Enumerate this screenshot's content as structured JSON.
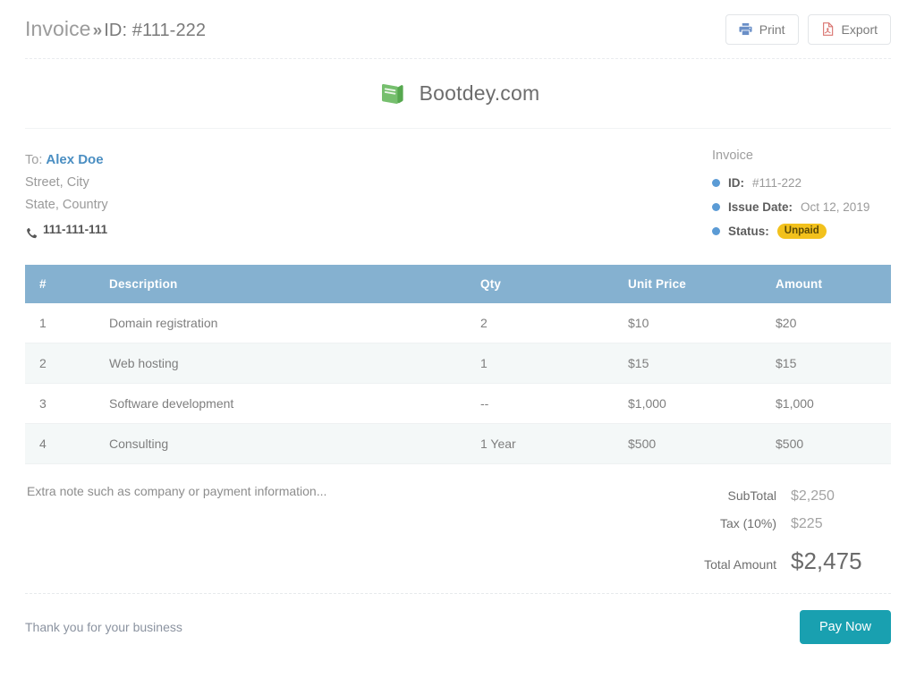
{
  "breadcrumb": {
    "root": "Invoice",
    "separator": "»",
    "id_label": "ID: #111-222"
  },
  "top_actions": {
    "print": {
      "label": "Print",
      "icon": "printer-icon",
      "icon_color": "#6a8fc7"
    },
    "export": {
      "label": "Export",
      "icon": "pdf-file-icon",
      "icon_color": "#d9736f"
    }
  },
  "brand": {
    "name": "Bootdey.com",
    "logo_icon": "book-icon",
    "logo_color": "#6bb26b"
  },
  "bill_to": {
    "prefix": "To:",
    "name": "Alex Doe",
    "address_line_1": "Street, City",
    "address_line_2": "State, Country",
    "phone": "111-111-111",
    "phone_icon": "phone-icon"
  },
  "invoice_meta": {
    "heading": "Invoice",
    "rows": [
      {
        "label": "ID:",
        "value": "#111-222"
      },
      {
        "label": "Issue Date:",
        "value": "Oct 12, 2019"
      },
      {
        "label": "Status:",
        "value": ""
      }
    ],
    "status_badge": "Unpaid",
    "bullet_color": "#5b9bd5",
    "badge_color": "#f2c11c"
  },
  "items_table": {
    "columns": [
      "#",
      "Description",
      "Qty",
      "Unit Price",
      "Amount"
    ],
    "header_bg": "#85b1d0",
    "rows": [
      {
        "num": "1",
        "description": "Domain registration",
        "qty": "2",
        "unit_price": "$10",
        "amount": "$20"
      },
      {
        "num": "2",
        "description": "Web hosting",
        "qty": "1",
        "unit_price": "$15",
        "amount": "$15"
      },
      {
        "num": "3",
        "description": "Software development",
        "qty": "--",
        "unit_price": "$1,000",
        "amount": "$1,000"
      },
      {
        "num": "4",
        "description": "Consulting",
        "qty": "1 Year",
        "unit_price": "$500",
        "amount": "$500"
      }
    ]
  },
  "note": "Extra note such as company or payment information...",
  "totals": {
    "subtotal_label": "SubTotal",
    "subtotal_value": "$2,250",
    "tax_label": "Tax (10%)",
    "tax_value": "$225",
    "total_label": "Total Amount",
    "total_value": "$2,475"
  },
  "footer": {
    "thanks": "Thank you for your business",
    "pay_button": "Pay Now",
    "pay_button_color": "#19a0b0"
  }
}
